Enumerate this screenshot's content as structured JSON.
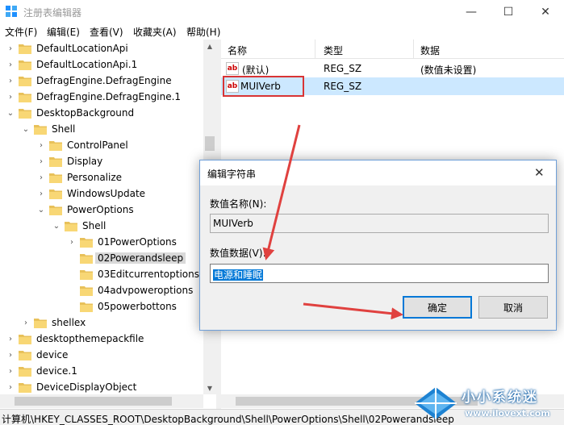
{
  "window": {
    "title": "注册表编辑器",
    "minimize": "—",
    "maximize": "☐",
    "close": "✕"
  },
  "menu": [
    "文件(F)",
    "编辑(E)",
    "查看(V)",
    "收藏夹(A)",
    "帮助(H)"
  ],
  "tree": [
    {
      "label": "DefaultLocationApi",
      "level": 0,
      "arrow": "›"
    },
    {
      "label": "DefaultLocationApi.1",
      "level": 0,
      "arrow": "›"
    },
    {
      "label": "DefragEngine.DefragEngine",
      "level": 0,
      "arrow": "›"
    },
    {
      "label": "DefragEngine.DefragEngine.1",
      "level": 0,
      "arrow": "›"
    },
    {
      "label": "DesktopBackground",
      "level": 0,
      "arrow": "⌄"
    },
    {
      "label": "Shell",
      "level": 1,
      "arrow": "⌄"
    },
    {
      "label": "ControlPanel",
      "level": 2,
      "arrow": "›"
    },
    {
      "label": "Display",
      "level": 2,
      "arrow": "›"
    },
    {
      "label": "Personalize",
      "level": 2,
      "arrow": "›"
    },
    {
      "label": "WindowsUpdate",
      "level": 2,
      "arrow": "›"
    },
    {
      "label": "PowerOptions",
      "level": 2,
      "arrow": "⌄"
    },
    {
      "label": "Shell",
      "level": 3,
      "arrow": "⌄"
    },
    {
      "label": "01PowerOptions",
      "level": 4,
      "arrow": "›"
    },
    {
      "label": "02Powerandsleep",
      "level": 4,
      "arrow": "",
      "selected": true
    },
    {
      "label": "03Editcurrentoptions",
      "level": 4,
      "arrow": ""
    },
    {
      "label": "04advpoweroptions",
      "level": 4,
      "arrow": ""
    },
    {
      "label": "05powerbottons",
      "level": 4,
      "arrow": ""
    },
    {
      "label": "shellex",
      "level": 1,
      "arrow": "›"
    },
    {
      "label": "desktopthemepackfile",
      "level": 0,
      "arrow": "›"
    },
    {
      "label": "device",
      "level": 0,
      "arrow": "›"
    },
    {
      "label": "device.1",
      "level": 0,
      "arrow": "›"
    },
    {
      "label": "DeviceDisplayObject",
      "level": 0,
      "arrow": "›"
    }
  ],
  "list": {
    "headers": [
      "名称",
      "类型",
      "数据"
    ],
    "rows": [
      {
        "icon": "ab",
        "name": "(默认)",
        "type": "REG_SZ",
        "data": "(数值未设置)"
      },
      {
        "icon": "ab",
        "name": "MUIVerb",
        "type": "REG_SZ",
        "data": "",
        "selected": true
      }
    ]
  },
  "status": "计算机\\HKEY_CLASSES_ROOT\\DesktopBackground\\Shell\\PowerOptions\\Shell\\02Powerandsleep",
  "dialog": {
    "title": "编辑字符串",
    "close": "✕",
    "name_label": "数值名称(N):",
    "name_value": "MUIVerb",
    "data_label": "数值数据(V):",
    "data_value": "电源和睡眠",
    "ok": "确定",
    "cancel": "取消"
  },
  "watermark": {
    "title": "小小系统迷",
    "url": "www.ilovext.com"
  },
  "colors": {
    "annotation_red": "#e0413f",
    "selection_blue": "#cce8ff",
    "text_selection": "#0078d7"
  }
}
